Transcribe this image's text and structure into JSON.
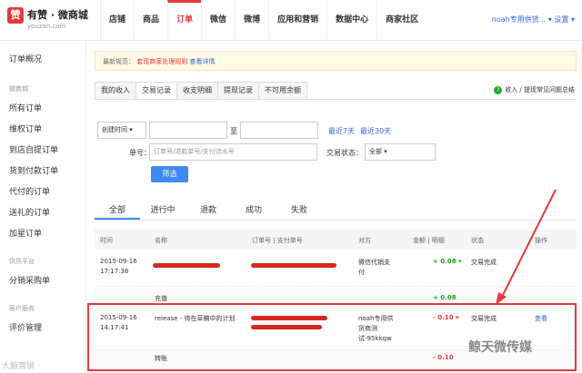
{
  "brand": {
    "name": "有赞 · 微商城",
    "sub": "youzan.com",
    "mark": "赞"
  },
  "nav": [
    "店铺",
    "商品",
    "订单",
    "微信",
    "微博",
    "应用和营销",
    "数据中心",
    "商家社区"
  ],
  "user": "noah专用供货... ▾  设置 ▾",
  "sidebar": {
    "top": "订单概况",
    "group1": "微商城",
    "items1": [
      "所有订单",
      "维权订单",
      "到店自提订单",
      "货到付款订单",
      "代付的订单",
      "送礼的订单",
      "加星订单"
    ],
    "group2": "供货平台",
    "items2": [
      "分销采购单"
    ],
    "group3": "客户服务",
    "items3": [
      "评价管理"
    ]
  },
  "notice": {
    "prefix": "最新规范：",
    "link": "套现商家处理规则",
    "more": "查看详情"
  },
  "tabs": [
    "我的收入",
    "交易记录",
    "收支明细",
    "提现记录",
    "不可用余额"
  ],
  "help": {
    "icon": "?",
    "text": "收入 / 提现常见问题总结"
  },
  "filter": {
    "time_select": "创建时间 ▾",
    "to": "至",
    "last7": "最近7天",
    "last30": "最近30天",
    "order_label": "单号：",
    "order_placeholder": "订单号/退款单号/支付流水号",
    "status_label": "交易状态：",
    "status_value": "全部 ▾",
    "button": "筛选"
  },
  "status_tabs": [
    "全部",
    "进行中",
    "退款",
    "成功",
    "失败"
  ],
  "columns": [
    "时间",
    "名称",
    "订单号 | 支付单号",
    "对方",
    "金额 | 明细",
    "状态",
    "操作"
  ],
  "rows": [
    {
      "date": "2015-09-16",
      "time": "17:17:36",
      "name": "",
      "party1": "微信代销支",
      "party2": "付",
      "amount": "+ 0.08 ▾",
      "status": "交易完成",
      "action": ""
    },
    {
      "name": "充值",
      "amount": "+ 0.08"
    },
    {
      "date": "2015-09-16",
      "time": "14:17:41",
      "name": "release - 待在草稿中的计划",
      "party1": "noah专用供",
      "party2": "货商测",
      "party3": "试-95kkqw",
      "amount": "- 0.10 ▾",
      "status": "交易完成",
      "action": "查看"
    },
    {
      "name": "转账",
      "amount": "- 0.10"
    }
  ],
  "watermark": "鲸天微传媒",
  "watermark2": "大鲸营销",
  "colors": {
    "accent": "#e4393c",
    "link": "#3366cc",
    "primary": "#3e8af2",
    "positive": "#1aad19"
  }
}
